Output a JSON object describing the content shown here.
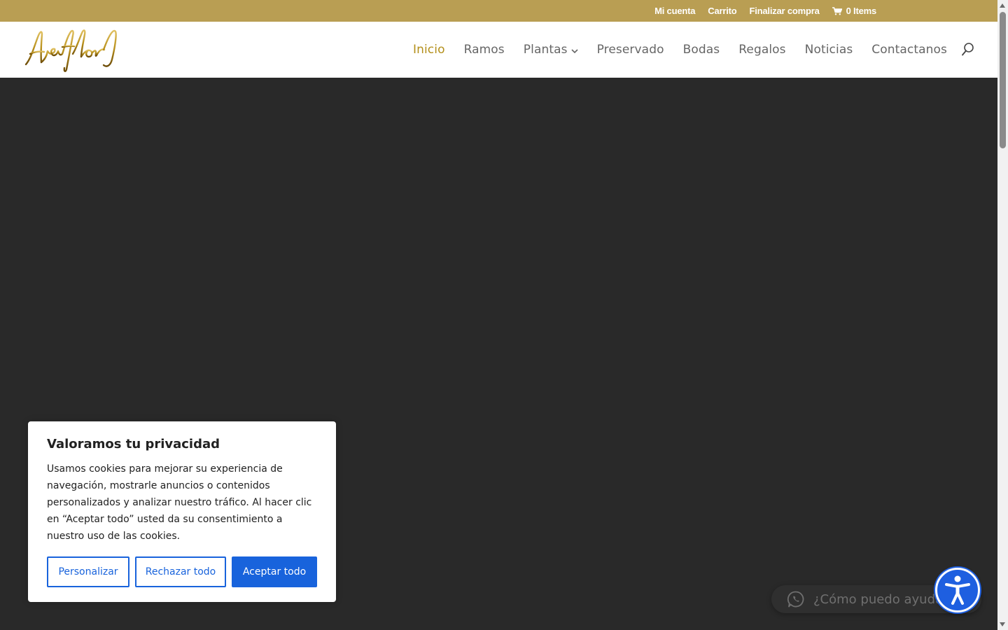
{
  "topbar": {
    "links": [
      "Mi cuenta",
      "Carrito",
      "Finalizar compra"
    ],
    "cart_label": "0 Items"
  },
  "brand": {
    "logo_text": "Araflor"
  },
  "nav": {
    "items": [
      {
        "label": "Inicio",
        "active": true
      },
      {
        "label": "Ramos"
      },
      {
        "label": "Plantas",
        "has_dropdown": true
      },
      {
        "label": "Preservado"
      },
      {
        "label": "Bodas"
      },
      {
        "label": "Regalos"
      },
      {
        "label": "Noticias"
      },
      {
        "label": "Contactanos"
      }
    ]
  },
  "cookie_banner": {
    "title": "Valoramos tu privacidad",
    "text": "Usamos cookies para mejorar su experiencia de navegación, mostrarle anuncios o contenidos personalizados y analizar nuestro tráfico. Al hacer clic en “Aceptar todo” usted da su consentimiento a nuestro uso de las cookies.",
    "customize_label": "Personalizar",
    "reject_label": "Rechazar todo",
    "accept_label": "Aceptar todo"
  },
  "whatsapp": {
    "placeholder": "¿Cómo puedo ayudarte?"
  },
  "colors": {
    "topbar": "#b99e53",
    "nav_active": "#b38f1a",
    "hero_bg": "#292929",
    "cookie_accent": "#1863dc",
    "accessibility": "#1e5fe0"
  }
}
